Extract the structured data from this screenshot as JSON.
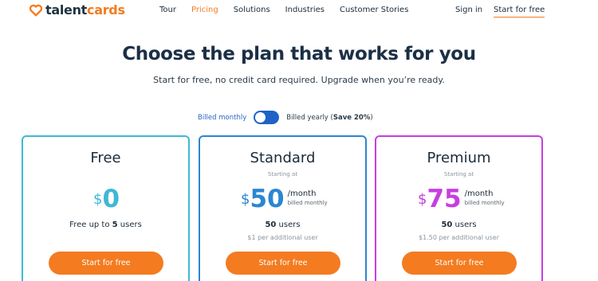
{
  "brand": {
    "name_part1": "talent",
    "name_part2": "cards",
    "accent_color": "#f47b20"
  },
  "nav": {
    "links": [
      "Tour",
      "Pricing",
      "Solutions",
      "Industries",
      "Customer Stories"
    ],
    "active": "Pricing",
    "sign_in": "Sign in",
    "start_free": "Start for free"
  },
  "hero": {
    "title": "Choose the plan that works for you",
    "subtitle": "Start for free, no credit card required. Upgrade when you’re ready."
  },
  "billing": {
    "monthly_label": "Billed monthly",
    "yearly_label": "Billed yearly",
    "yearly_discount": "Save 20%",
    "selected": "monthly"
  },
  "plans": [
    {
      "name": "Free",
      "starting_at": "",
      "currency": "$",
      "price": "0",
      "per_month": "",
      "billed": "",
      "users_prefix": "Free up to ",
      "users_count": "5",
      "users_suffix": " users",
      "extra": "",
      "cta": "Start for free",
      "color": "#3fb8d4"
    },
    {
      "name": "Standard",
      "starting_at": "Starting at",
      "currency": "$",
      "price": "50",
      "per_month": "/month",
      "billed": "billed monthly",
      "users_prefix": "",
      "users_count": "50",
      "users_suffix": " users",
      "extra": "$1 per additional user",
      "cta": "Start for free",
      "color": "#2c86d1"
    },
    {
      "name": "Premium",
      "starting_at": "Starting at",
      "currency": "$",
      "price": "75",
      "per_month": "/month",
      "billed": "billed monthly",
      "users_prefix": "",
      "users_count": "50",
      "users_suffix": " users",
      "extra": "$1.50 per additional user",
      "cta": "Start for free",
      "color": "#c63ee0"
    }
  ]
}
